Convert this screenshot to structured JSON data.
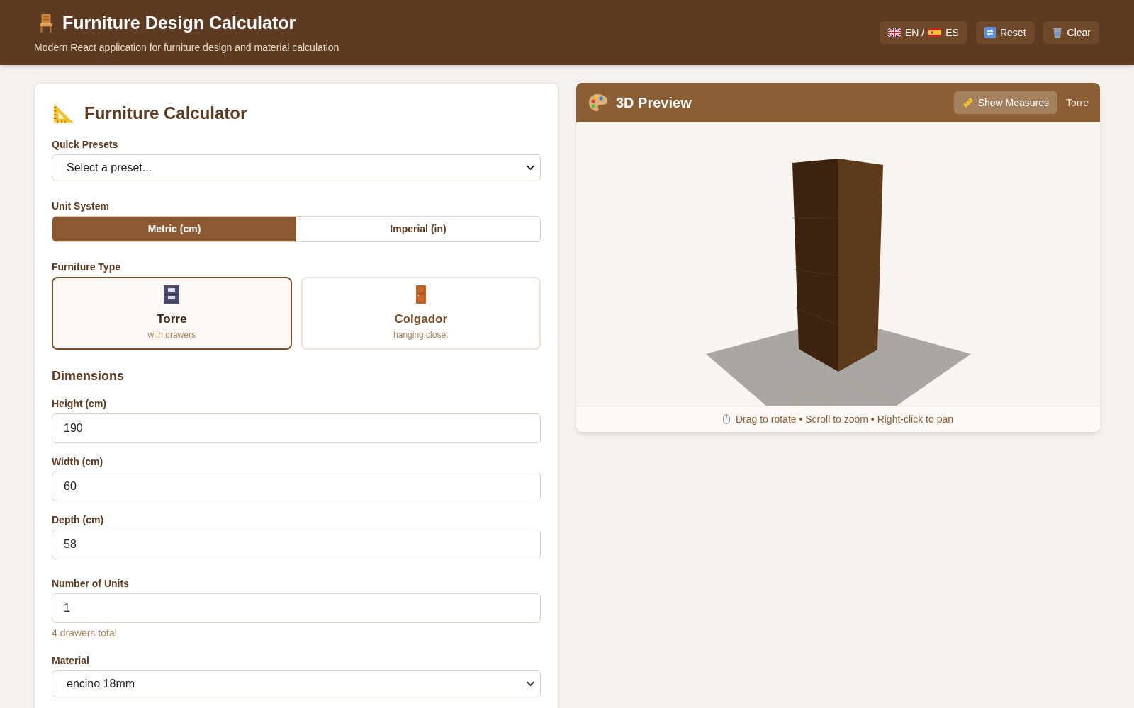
{
  "header": {
    "title": "Furniture Design Calculator",
    "subtitle": "Modern React application for furniture design and material calculation",
    "buttons": [
      {
        "kind": "language",
        "label_a": "EN /",
        "label_b": "ES"
      },
      {
        "kind": "reset",
        "label": "Reset"
      },
      {
        "kind": "clear",
        "label": "Clear"
      }
    ]
  },
  "calculator": {
    "title": "Furniture Calculator",
    "presets": {
      "label": "Quick Presets",
      "value": "Select a preset..."
    },
    "units": {
      "label": "Unit System",
      "options": [
        {
          "label": "Metric (cm)",
          "selected": true
        },
        {
          "label": "Imperial (in)",
          "selected": false
        }
      ]
    },
    "furniture_type": {
      "label": "Furniture Type",
      "options": [
        {
          "kind": "drawers",
          "name": "Torre",
          "description": "with drawers",
          "selected": true
        },
        {
          "kind": "door",
          "name": "Colgador",
          "description": "hanging closet",
          "selected": false
        }
      ]
    },
    "dimensions": {
      "title": "Dimensions",
      "fields": [
        {
          "label": "Height (cm)",
          "value": "190"
        },
        {
          "label": "Width (cm)",
          "value": "60"
        },
        {
          "label": "Depth (cm)",
          "value": "58"
        }
      ]
    },
    "units_count": {
      "label": "Number of Units",
      "value": "1",
      "hint": "4 drawers total"
    },
    "material": {
      "label": "Material",
      "value": "encino 18mm"
    }
  },
  "preview": {
    "title": "3D Preview",
    "measures_button": "Show Measures",
    "type_label": "Torre",
    "footer": "Drag to rotate • Scroll to zoom • Right-click to pan"
  }
}
